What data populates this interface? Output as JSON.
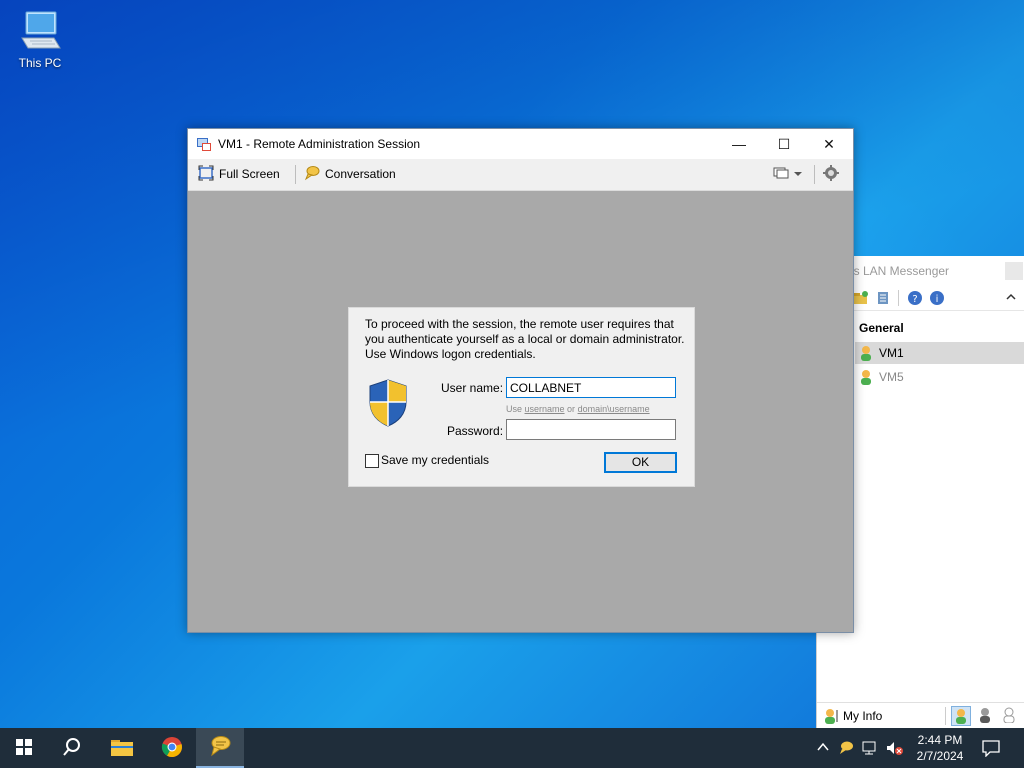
{
  "desktop": {
    "icons": [
      {
        "label": "This PC",
        "icon": "computer-icon"
      }
    ]
  },
  "lan_window": {
    "title": "os LAN Messenger",
    "group": "General",
    "users": [
      {
        "name": "VM1",
        "selected": true
      },
      {
        "name": "VM5",
        "selected": false
      }
    ],
    "my_info": "My Info"
  },
  "window": {
    "title": "VM1 - Remote Administration Session",
    "toolbar": {
      "full_screen": "Full Screen",
      "conversation": "Conversation"
    },
    "controls": {
      "minimize": "—",
      "maximize": "☐",
      "close": "✕"
    }
  },
  "auth_dialog": {
    "message": "To proceed with the session, the remote user requires that you authenticate yourself as a local or domain administrator. Use Windows logon credentials.",
    "user_label": "User name:",
    "user_value": "COLLABNET",
    "hint_prefix": "Use ",
    "hint_a": "username",
    "hint_mid": " or ",
    "hint_b": "domain\\username",
    "password_label": "Password:",
    "password_value": "",
    "save_label": "Save my credentials",
    "save_checked": false,
    "ok_label": "OK"
  },
  "taskbar": {
    "pinned": [
      "start-icon",
      "search-icon",
      "file-explorer-icon",
      "chrome-icon",
      "lan-messenger-icon"
    ],
    "tray": [
      "chevron-up-icon",
      "lan-messenger-tray-icon",
      "network-icon",
      "volume-muted-icon"
    ],
    "time": "2:44 PM",
    "date": "2/7/2024"
  },
  "colors": {
    "accent": "#0078d7",
    "taskbar": "#1f2d3a",
    "session_bg": "#a9a9a9"
  }
}
